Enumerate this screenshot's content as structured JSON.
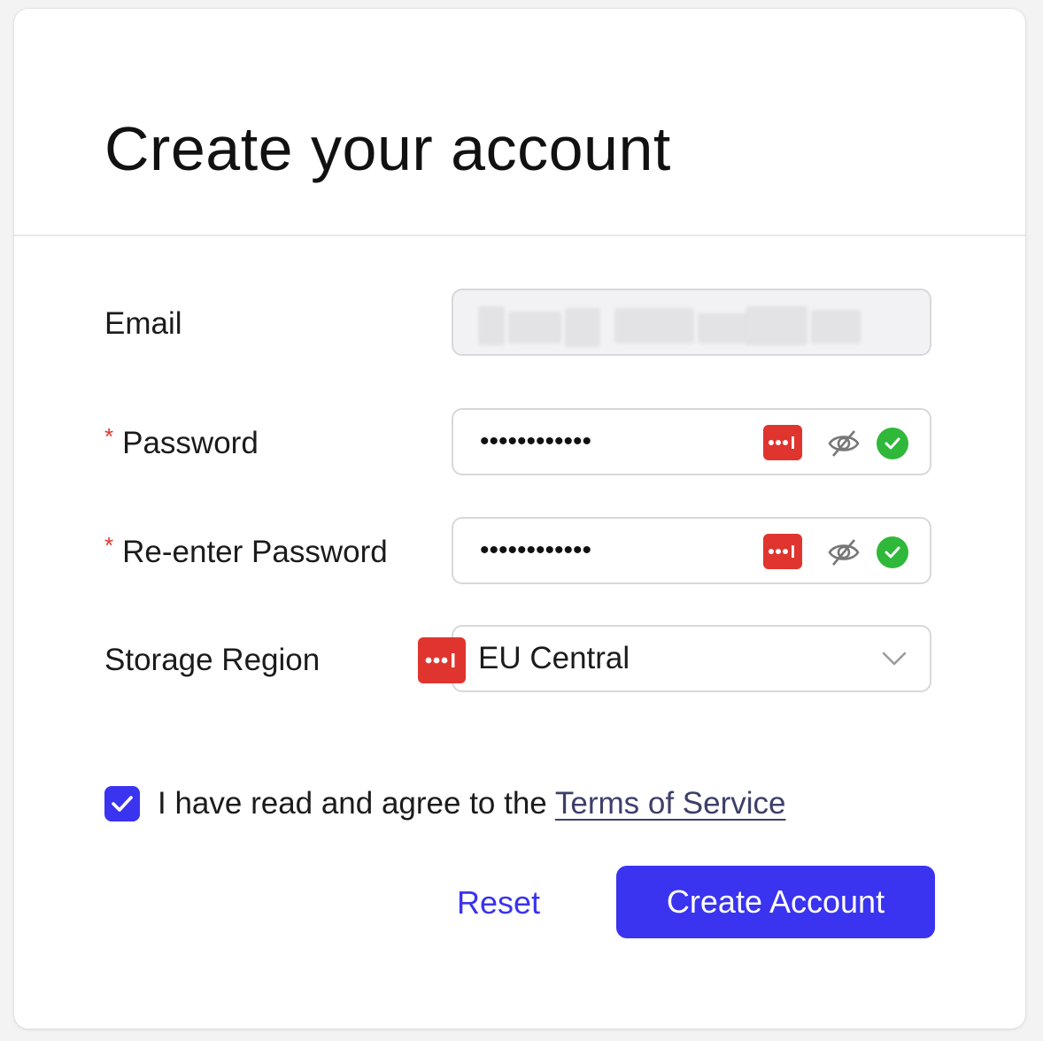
{
  "header": {
    "title": "Create your account"
  },
  "form": {
    "email": {
      "label": "Email",
      "value_obscured": true
    },
    "password": {
      "required_marker": "*",
      "label": "Password",
      "masked_value": "••••••••••••",
      "valid": true
    },
    "confirm_password": {
      "required_marker": "*",
      "label": "Re-enter Password",
      "masked_value": "••••••••••••",
      "valid": true
    },
    "storage_region": {
      "label": "Storage Region",
      "selected": "EU Central"
    }
  },
  "agreement": {
    "checked": true,
    "text": "I have read and agree to the ",
    "link_text": "Terms of Service"
  },
  "actions": {
    "reset_label": "Reset",
    "submit_label": "Create Account"
  },
  "icons": {
    "password_manager": "lastpass-icon",
    "visibility": "eye-off-icon",
    "valid": "check-circle-icon",
    "dropdown": "chevron-down-icon",
    "checkbox": "checkmark-icon"
  },
  "colors": {
    "primary": "#3a33f0",
    "required": "#e0352b",
    "success": "#2fb83a",
    "password_manager": "#e0342f",
    "link": "#3d3f6a"
  }
}
